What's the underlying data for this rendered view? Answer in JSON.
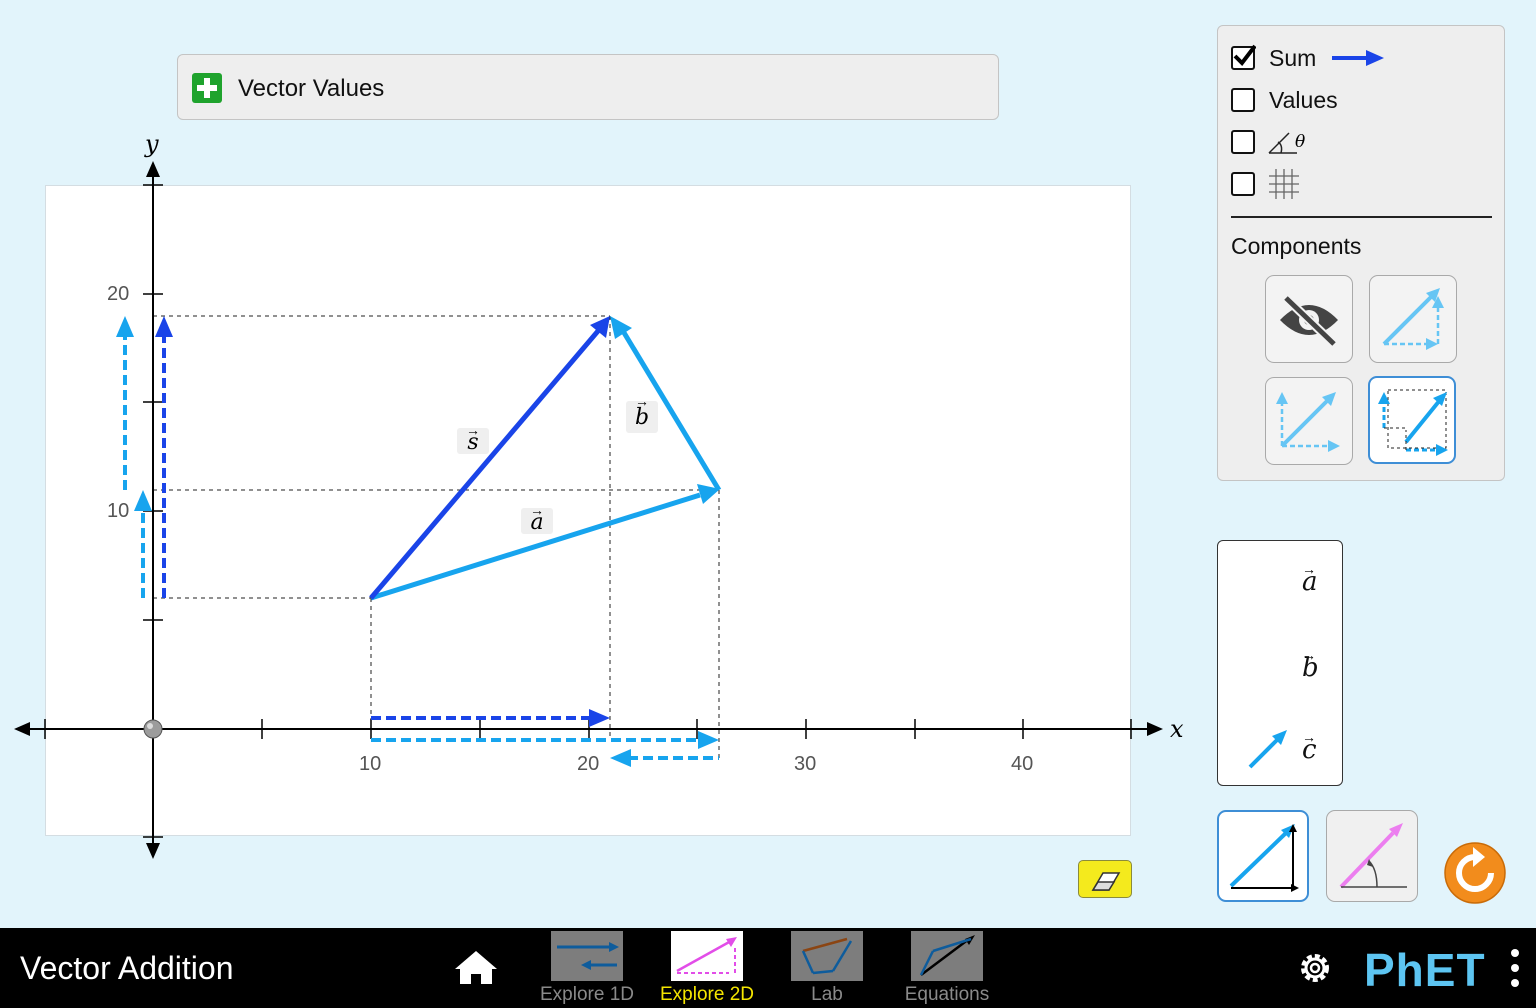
{
  "vector_values": {
    "title": "Vector Values"
  },
  "graph": {
    "x_axis_label": "x",
    "y_axis_label": "y",
    "x_tick_labels": [
      "10",
      "20",
      "30",
      "40"
    ],
    "y_tick_labels": [
      "10",
      "20"
    ],
    "vector_labels": {
      "sum": "s",
      "a": "a",
      "b": "b"
    },
    "colors": {
      "sum": "#1a44e8",
      "a": "#17a4ee",
      "b": "#17a4ee",
      "component_sum": "#1a44e8",
      "component_ab": "#17a4ee"
    }
  },
  "controls": {
    "sum_label": "Sum",
    "sum_checked": true,
    "values_label": "Values",
    "values_checked": false,
    "angle_checked": false,
    "grid_checked": false,
    "angle_symbol": "θ",
    "components_label": "Components",
    "component_modes": [
      {
        "name": "hidden",
        "icon": "eye-slash-icon",
        "selected": false
      },
      {
        "name": "triangle",
        "icon": "triangle-components-icon",
        "selected": false
      },
      {
        "name": "parallelogram",
        "icon": "parallelogram-components-icon",
        "selected": false
      },
      {
        "name": "on-axis",
        "icon": "on-axis-components-icon",
        "selected": true
      }
    ]
  },
  "toolbox": {
    "labels": [
      "a",
      "b",
      "c"
    ]
  },
  "coordinate_modes": [
    {
      "name": "cartesian",
      "icon": "cartesian-icon",
      "selected": true
    },
    {
      "name": "polar",
      "icon": "polar-icon",
      "selected": false
    }
  ],
  "navbar": {
    "title": "Vector Addition",
    "tabs": [
      {
        "label": "Explore 1D",
        "active": false
      },
      {
        "label": "Explore 2D",
        "active": true
      },
      {
        "label": "Lab",
        "active": false
      },
      {
        "label": "Equations",
        "active": false
      }
    ],
    "brand": "PhET"
  }
}
